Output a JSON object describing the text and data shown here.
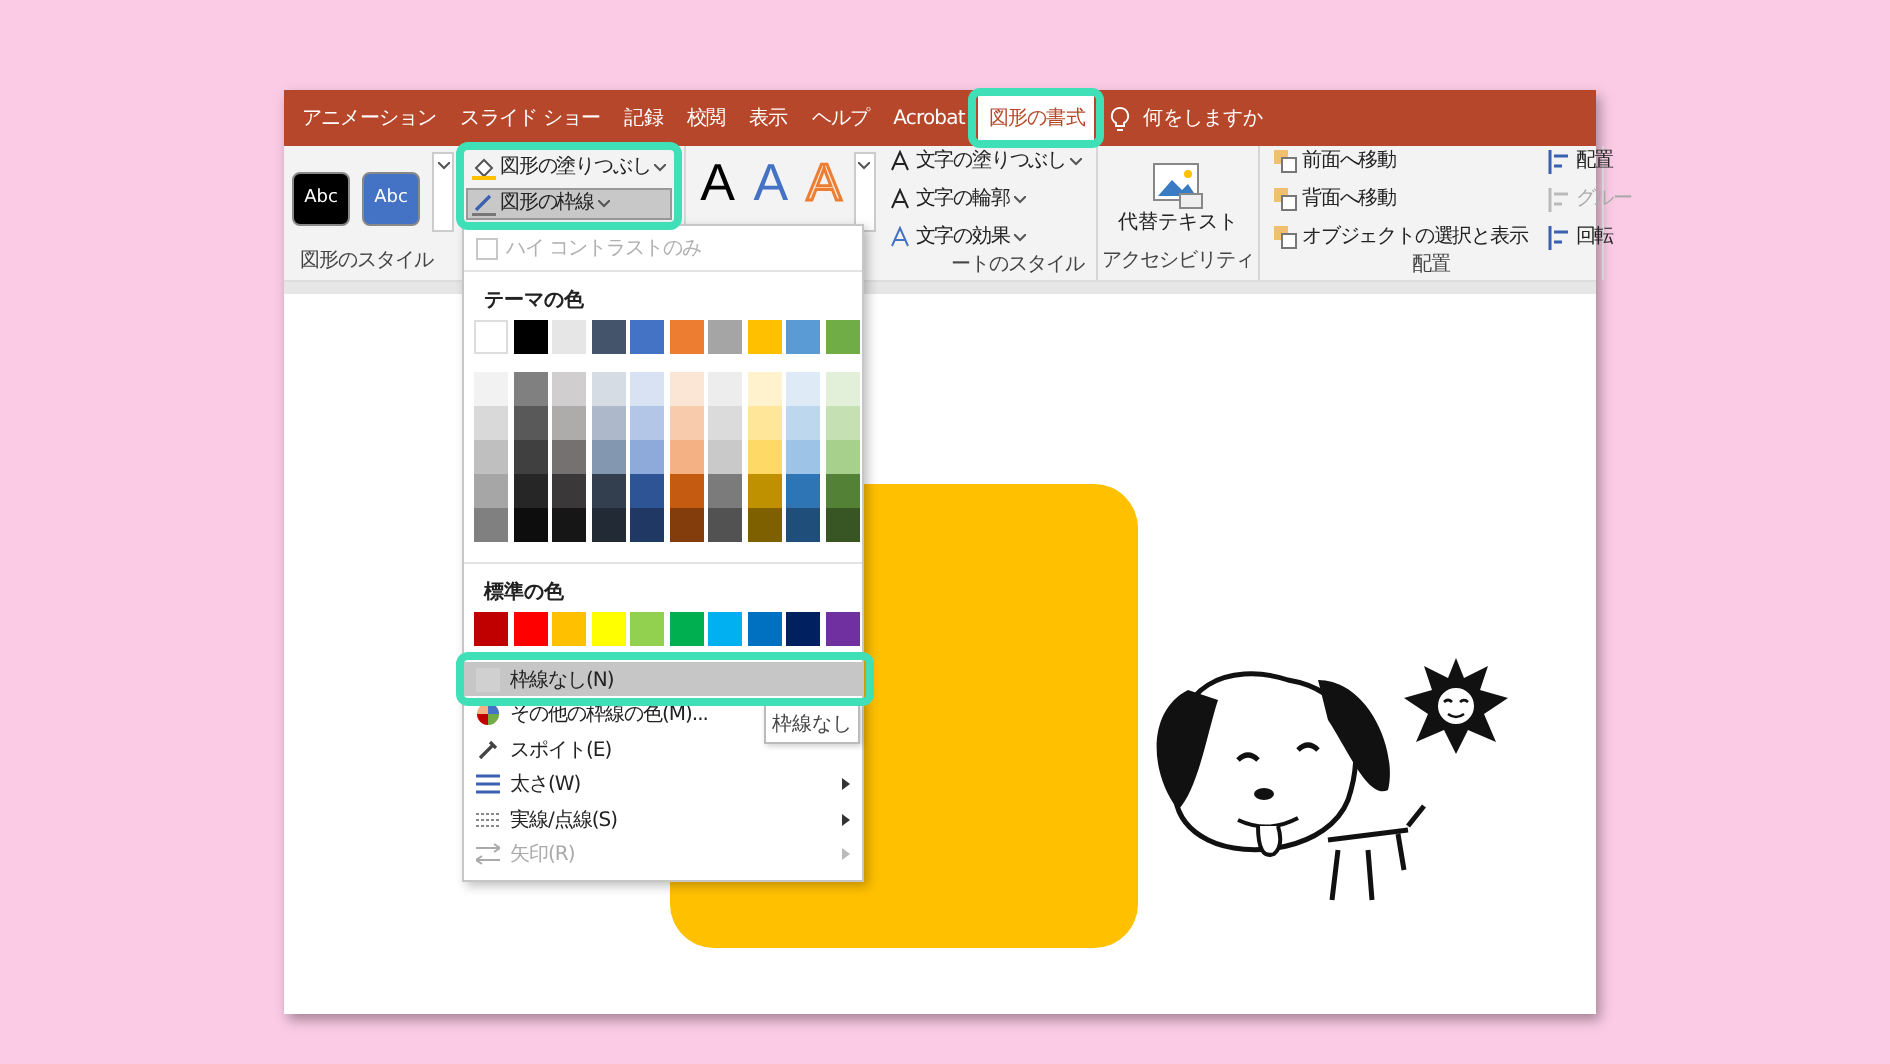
{
  "ribbon_tabs": [
    {
      "label": "アニメーション",
      "selected": false
    },
    {
      "label": "スライド ショー",
      "selected": false
    },
    {
      "label": "記録",
      "selected": false
    },
    {
      "label": "校閲",
      "selected": false
    },
    {
      "label": "表示",
      "selected": false
    },
    {
      "label": "ヘルプ",
      "selected": false
    },
    {
      "label": "Acrobat",
      "selected": false
    },
    {
      "label": "図形の書式",
      "selected": true
    }
  ],
  "tell_me": "何をしますか",
  "shape_styles": {
    "presets": [
      {
        "label": "Abc",
        "color": "#000000"
      },
      {
        "label": "Abc",
        "color": "#4472c4"
      }
    ],
    "fill_button": {
      "label": "図形の塗りつぶし",
      "pressed": false
    },
    "outline_button": {
      "label": "図形の枠線",
      "pressed": true
    },
    "group_label": "図形のスタイル"
  },
  "wordart": {
    "letters": [
      {
        "label": "A",
        "kind": "solid"
      },
      {
        "label": "A",
        "kind": "blue"
      },
      {
        "label": "A",
        "kind": "outline"
      }
    ],
    "buttons": [
      "文字の塗りつぶし",
      "文字の輪郭",
      "文字の効果"
    ],
    "group_label": "ートのスタイル"
  },
  "accessibility": {
    "button": "代替テキスト",
    "group_label": "アクセシビリティ"
  },
  "arrange": {
    "buttons": [
      {
        "label": "前面へ移動",
        "disabled": false
      },
      {
        "label": "背面へ移動",
        "disabled": false
      },
      {
        "label": "オブジェクトの選択と表示",
        "disabled": false
      }
    ],
    "side_buttons": [
      {
        "label": "配置",
        "disabled": false
      },
      {
        "label": "グルー",
        "disabled": true
      },
      {
        "label": "回転",
        "disabled": false
      }
    ],
    "group_label": "配置"
  },
  "outline_menu": {
    "high_contrast": {
      "label": "ハイ コントラストのみ",
      "checked": false,
      "disabled": true
    },
    "theme_title": "テーマの色",
    "theme_colors": [
      {
        "color": "#ffffff"
      },
      {
        "color": "#000000"
      },
      {
        "color": "#e7e6e6"
      },
      {
        "color": "#44546a"
      },
      {
        "color": "#4472c4"
      },
      {
        "color": "#ed7d31"
      },
      {
        "color": "#a5a5a5"
      },
      {
        "color": "#ffc000"
      },
      {
        "color": "#5b9bd5"
      },
      {
        "color": "#70ad47"
      }
    ],
    "theme_shades": [
      [
        {
          "color": "#f2f2f2"
        },
        {
          "color": "#d9d9d9"
        },
        {
          "color": "#bfbfbf"
        },
        {
          "color": "#a6a6a6"
        },
        {
          "color": "#808080"
        }
      ],
      [
        {
          "color": "#808080"
        },
        {
          "color": "#595959"
        },
        {
          "color": "#404040"
        },
        {
          "color": "#262626"
        },
        {
          "color": "#0d0d0d"
        }
      ],
      [
        {
          "color": "#d0cece"
        },
        {
          "color": "#aeabab"
        },
        {
          "color": "#757171"
        },
        {
          "color": "#3a3838"
        },
        {
          "color": "#171616"
        }
      ],
      [
        {
          "color": "#d6dce4"
        },
        {
          "color": "#adb9ca"
        },
        {
          "color": "#8497b0"
        },
        {
          "color": "#333f4f"
        },
        {
          "color": "#222a35"
        }
      ],
      [
        {
          "color": "#d9e2f3"
        },
        {
          "color": "#b4c6e7"
        },
        {
          "color": "#8eaadb"
        },
        {
          "color": "#2f5496"
        },
        {
          "color": "#1f3864"
        }
      ],
      [
        {
          "color": "#fbe5d5"
        },
        {
          "color": "#f7cbac"
        },
        {
          "color": "#f4b183"
        },
        {
          "color": "#c55a11"
        },
        {
          "color": "#833c0b"
        }
      ],
      [
        {
          "color": "#ededed"
        },
        {
          "color": "#dbdbdb"
        },
        {
          "color": "#c9c9c9"
        },
        {
          "color": "#7b7b7b"
        },
        {
          "color": "#525252"
        }
      ],
      [
        {
          "color": "#fff2cc"
        },
        {
          "color": "#ffe699"
        },
        {
          "color": "#ffd966"
        },
        {
          "color": "#bf9000"
        },
        {
          "color": "#7f6000"
        }
      ],
      [
        {
          "color": "#deebf6"
        },
        {
          "color": "#bdd7ee"
        },
        {
          "color": "#9dc3e6"
        },
        {
          "color": "#2e75b5"
        },
        {
          "color": "#1e4e79"
        }
      ],
      [
        {
          "color": "#e2efd9"
        },
        {
          "color": "#c5e0b3"
        },
        {
          "color": "#a8d08d"
        },
        {
          "color": "#538135"
        },
        {
          "color": "#375623"
        }
      ]
    ],
    "standard_title": "標準の色",
    "standard_colors": [
      {
        "color": "#c00000"
      },
      {
        "color": "#ff0000"
      },
      {
        "color": "#ffc000"
      },
      {
        "color": "#ffff00"
      },
      {
        "color": "#92d050"
      },
      {
        "color": "#00b050"
      },
      {
        "color": "#00b0f0"
      },
      {
        "color": "#0070c0"
      },
      {
        "color": "#002060"
      },
      {
        "color": "#7030a0"
      }
    ],
    "items": [
      {
        "label": "枠線なし(N)",
        "kind": "none",
        "highlighted": true,
        "disabled": false,
        "submenu": false
      },
      {
        "label": "その他の枠線の色(M)...",
        "kind": "palette",
        "highlighted": false,
        "disabled": false,
        "submenu": false
      },
      {
        "label": "スポイト(E)",
        "kind": "eyedropper",
        "highlighted": false,
        "disabled": false,
        "submenu": false
      },
      {
        "label": "太さ(W)",
        "kind": "weight",
        "highlighted": false,
        "disabled": false,
        "submenu": true
      },
      {
        "label": "実線/点線(S)",
        "kind": "dash",
        "highlighted": false,
        "disabled": false,
        "submenu": true
      },
      {
        "label": "矢印(R)",
        "kind": "arrow",
        "highlighted": false,
        "disabled": true,
        "submenu": true
      }
    ]
  },
  "tooltip": "枠線なし"
}
